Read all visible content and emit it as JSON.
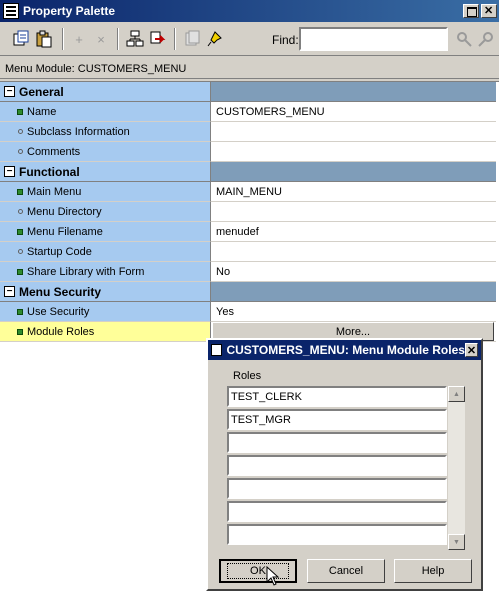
{
  "window": {
    "title": "Property Palette"
  },
  "toolbar": {
    "tools": [
      {
        "name": "copy-properties-icon"
      },
      {
        "name": "paste-properties-icon"
      },
      {
        "name": "add-property-icon"
      },
      {
        "name": "delete-property-icon"
      },
      {
        "name": "intersection-union-icon"
      },
      {
        "name": "inherit-icon"
      },
      {
        "name": "freeze-icon"
      },
      {
        "name": "pin-icon"
      },
      {
        "name": "find-next-icon"
      },
      {
        "name": "find-previous-icon"
      }
    ],
    "find_label": "Find:",
    "find_value": ""
  },
  "context": {
    "label": "Menu Module: CUSTOMERS_MENU"
  },
  "grid": {
    "general": {
      "category": "General",
      "rows": [
        {
          "name": "Name",
          "value": "CUSTOMERS_MENU"
        },
        {
          "name": "Subclass Information",
          "value": ""
        },
        {
          "name": "Comments",
          "value": ""
        }
      ]
    },
    "functional": {
      "category": "Functional",
      "rows": [
        {
          "name": "Main Menu",
          "value": "MAIN_MENU"
        },
        {
          "name": "Menu Directory",
          "value": ""
        },
        {
          "name": "Menu Filename",
          "value": "menudef"
        },
        {
          "name": "Startup Code",
          "value": ""
        },
        {
          "name": "Share Library with Form",
          "value": "No"
        }
      ]
    },
    "security": {
      "category": "Menu Security",
      "rows": [
        {
          "name": "Use Security",
          "value": "Yes"
        },
        {
          "name": "Module Roles",
          "value": "More..."
        }
      ]
    },
    "toggle_symbol": "−"
  },
  "dialog": {
    "title": "CUSTOMERS_MENU: Menu Module Roles",
    "roles_label": "Roles",
    "roles": [
      "TEST_CLERK",
      "TEST_MGR",
      "",
      "",
      "",
      "",
      "",
      ""
    ],
    "ok_label": "OK",
    "cancel_label": "Cancel",
    "help_label": "Help"
  }
}
